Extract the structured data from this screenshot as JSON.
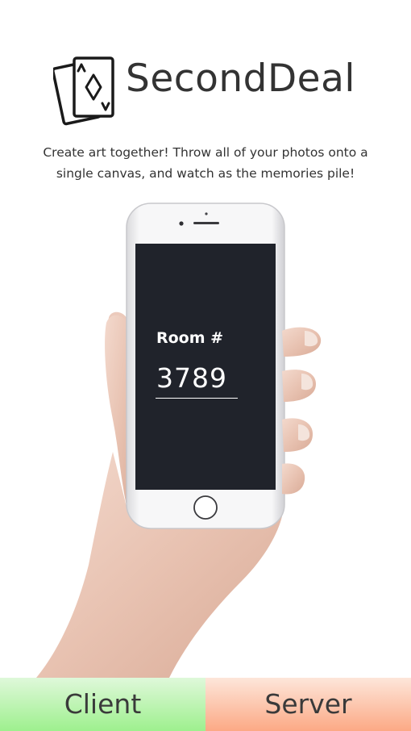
{
  "app": {
    "title": "SecondDeal",
    "tagline_line1": "Create art together! Throw all of your photos onto a",
    "tagline_line2": "single canvas, and watch as the memories pile!"
  },
  "hero": {
    "room_label": "Room #",
    "room_value": "3789"
  },
  "actions": {
    "client_label": "Client",
    "server_label": "Server"
  },
  "icons": {
    "logo": "playing-cards-icon"
  },
  "colors": {
    "client_button_top": "#dff8da",
    "client_button_bottom": "#9ef08e",
    "server_button_top": "#fde6da",
    "server_button_bottom": "#fca985",
    "screen": "#20232b"
  }
}
